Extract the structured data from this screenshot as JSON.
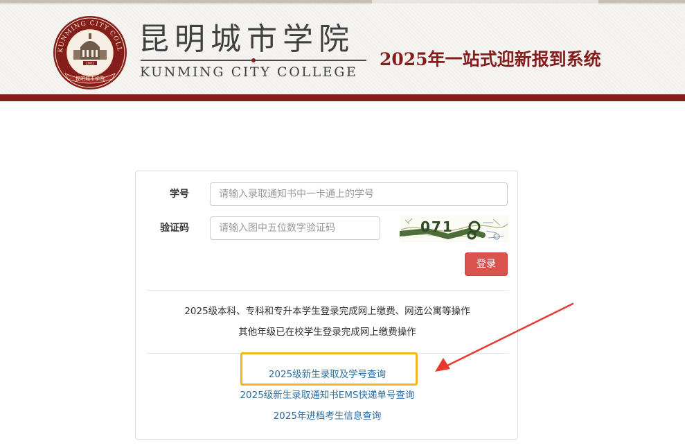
{
  "header": {
    "college_name_cn": "昆明城市学院",
    "college_name_en": "KUNMING CITY COLLEGE",
    "system_title": "2025年一站式迎新报到系统",
    "logo": {
      "ring_text": "KUNMING CITY COLLEGE",
      "banner_text": "昆明城市学院",
      "year": "2001",
      "icon": "college-seal-icon"
    }
  },
  "login_form": {
    "student_id_label": "学号",
    "student_id_value": "",
    "student_id_placeholder": "请输入录取通知书中一卡通上的学号",
    "captcha_label": "验证码",
    "captcha_value": "",
    "captcha_placeholder": "请输入图中五位数字验证码",
    "captcha_image_text": "071",
    "login_button": "登录"
  },
  "info": {
    "line1": "2025级本科、专科和专升本学生登录完成网上缴费、网选公寓等操作",
    "line2": "其他年级已在校学生登录完成网上缴费操作"
  },
  "links": [
    {
      "label": "2025级新生录取及学号查询"
    },
    {
      "label": "2025级新生录取通知书EMS快递单号查询"
    },
    {
      "label": "2025年进档考生信息查询"
    }
  ],
  "annotation": {
    "highlight_color": "#f3b71d",
    "arrow_color": "#e8382f"
  },
  "colors": {
    "brand": "#861d1d",
    "button": "#d9534f",
    "link": "#2a6ea5"
  }
}
